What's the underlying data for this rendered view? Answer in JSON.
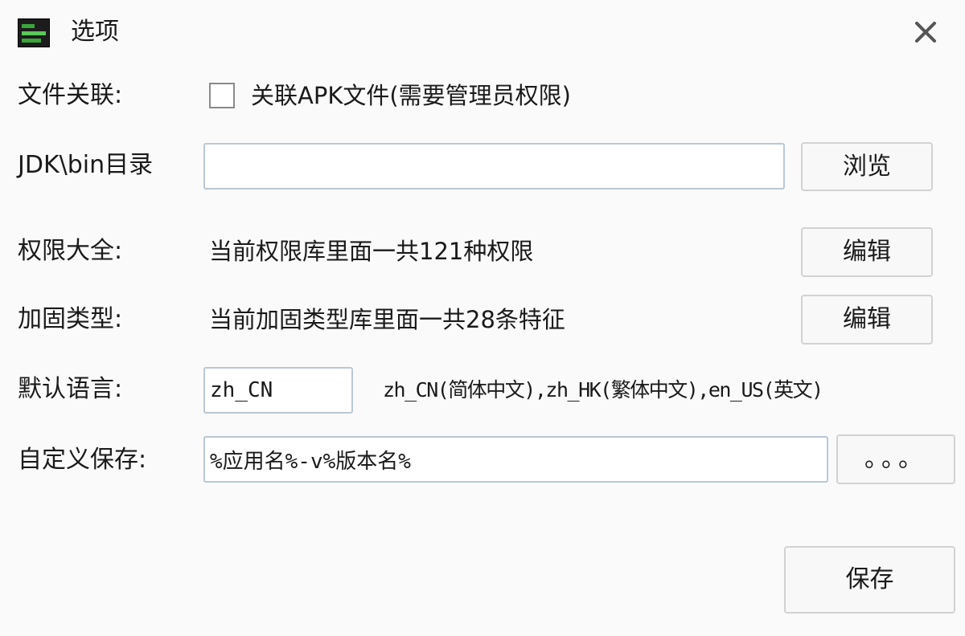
{
  "window": {
    "title": "选项",
    "icon": "app-icon",
    "close_icon": "close-icon"
  },
  "file_association": {
    "label": "文件关联:",
    "checkbox_label": "关联APK文件(需要管理员权限)",
    "checked": false
  },
  "jdk": {
    "label": "JDK\\bin目录",
    "value": "",
    "browse_label": "浏览"
  },
  "permissions": {
    "label": "权限大全:",
    "info": "当前权限库里面一共121种权限",
    "edit_label": "编辑"
  },
  "hardening": {
    "label": "加固类型:",
    "info": "当前加固类型库里面一共28条特征",
    "edit_label": "编辑"
  },
  "language": {
    "label": "默认语言:",
    "value": "zh_CN",
    "hint": "zh_CN(简体中文),zh_HK(繁体中文),en_US(英文)"
  },
  "custom_save": {
    "label": "自定义保存:",
    "value": "%应用名%-v%版本名%",
    "more_label": "。。。"
  },
  "footer": {
    "save_label": "保存"
  },
  "colors": {
    "background": "#fafafa",
    "input_border": "#b9c8d6",
    "button_border": "#d2d2d2",
    "icon_green": "#3aa53a"
  }
}
